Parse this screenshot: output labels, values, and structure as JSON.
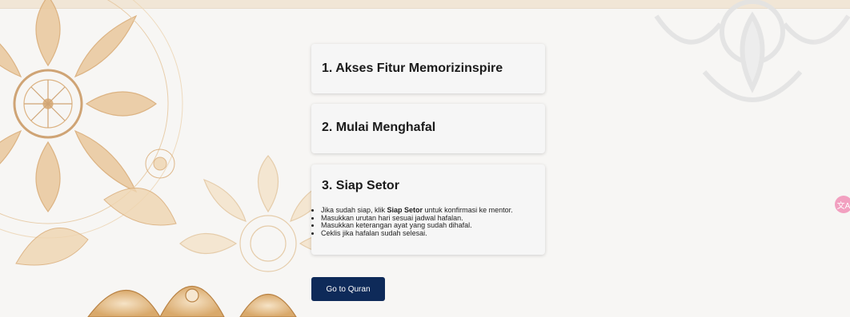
{
  "cards": [
    {
      "title": "1. Akses Fitur Memorizinspire"
    },
    {
      "title": "2. Mulai Menghafal"
    },
    {
      "title": "3. Siap Setor",
      "steps": {
        "step1_prefix": "Jika sudah siap, klik ",
        "step1_bold": "Siap Setor",
        "step1_suffix": " untuk konfirmasi ke mentor.",
        "step2": "Masukkan urutan hari sesuai jadwal hafalan.",
        "step3": "Masukkan keterangan ayat yang sudah dihafal.",
        "step4": "Ceklis jika hafalan sudah selesai."
      }
    }
  ],
  "go_button": {
    "label": "Go to Quran"
  },
  "floating_button": {
    "icon": "translate-icon"
  },
  "colors": {
    "button": "#0e2a59",
    "ornament_gold": "#d9a96b",
    "ornament_gray": "#e4e4e4",
    "float_pink": "#f2a0c0"
  }
}
